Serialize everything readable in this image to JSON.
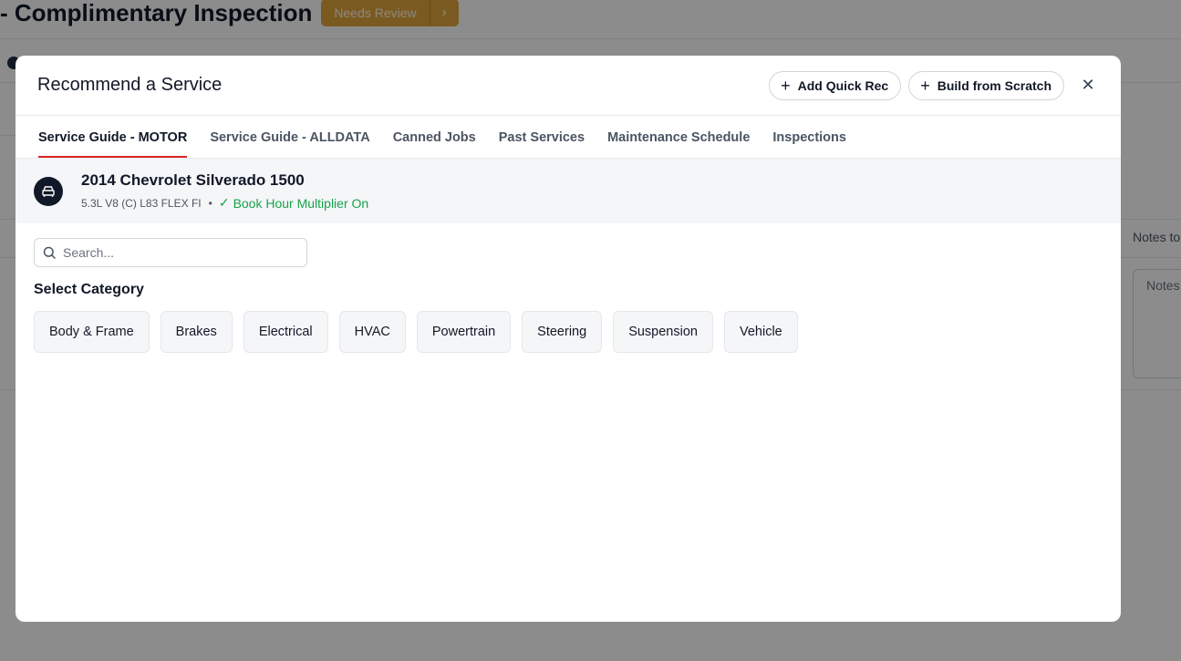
{
  "background": {
    "page_title": "- Complimentary Inspection",
    "status": "Needs Review",
    "status_arrow": "›",
    "notes_label": "Notes to",
    "notes_placeholder": "Notes"
  },
  "modal": {
    "title": "Recommend a Service",
    "buttons": {
      "add_quick_rec": "Add Quick Rec",
      "build_from_scratch": "Build from Scratch",
      "plus_icon": "+",
      "close_icon": "✕"
    },
    "tabs": [
      {
        "label": "Service Guide - MOTOR",
        "active": true
      },
      {
        "label": "Service Guide - ALLDATA",
        "active": false
      },
      {
        "label": "Canned Jobs",
        "active": false
      },
      {
        "label": "Past Services",
        "active": false
      },
      {
        "label": "Maintenance Schedule",
        "active": false
      },
      {
        "label": "Inspections",
        "active": false
      }
    ],
    "vehicle": {
      "name": "2014 Chevrolet Silverado 1500",
      "engine": "5.3L V8 (C) L83 FLEX FI",
      "separator": "•",
      "check_icon": "✓",
      "book_hour": "Book Hour Multiplier On"
    },
    "search": {
      "placeholder": "Search..."
    },
    "category_title": "Select Category",
    "categories": [
      "Body & Frame",
      "Brakes",
      "Electrical",
      "HVAC",
      "Powertrain",
      "Steering",
      "Suspension",
      "Vehicle"
    ]
  },
  "colors": {
    "accent_tab": "#dc2626",
    "status_pill": "#e0a43d",
    "success": "#16a34a"
  }
}
